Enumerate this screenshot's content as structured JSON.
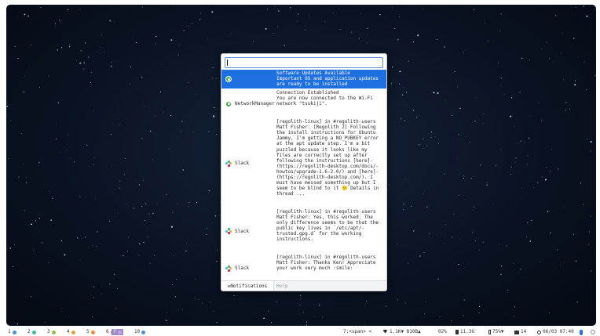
{
  "launcher": {
    "search_value": "",
    "notifications": [
      {
        "app": "",
        "icon": "network-manager-icon",
        "lines": [
          "Software Updates Available",
          "Important OS and application updates",
          "are ready to be installed"
        ],
        "selected": true
      },
      {
        "app": "NetworkManager",
        "icon": "network-manager-icon",
        "lines": [
          "Connection Established",
          "You are now connected to the Wi-Fi",
          "network \"tsukiji\"."
        ],
        "selected": false
      },
      {
        "app": "Slack",
        "icon": "slack-icon",
        "lines": [
          "[regolith-linux] in #regolith-users",
          "Matt Fisher: [Regolith 2] Following",
          "the install instructions for Ubuntu",
          "Jammy, I'm getting a NO_PUBKEY error",
          "at the apt update step. I'm a bit",
          "puzzled because it looks like my",
          "files are correctly set up after",
          "following the instructions [here]-",
          "(https://regolith-desktop.com/docs/-",
          "howtos/upgrade-1.6-2.0/) and [here]-",
          "(https://regolith-desktop.com/). I",
          "must have messed something up but I",
          "seem to be blind to it 😕 Details in",
          "thread ..."
        ],
        "selected": false
      },
      {
        "app": "Slack",
        "icon": "slack-icon",
        "lines": [
          "[regolith-linux] in #regolith-users",
          "Matt Fisher: Yes, this worked. The",
          "only difference seems to be that the",
          "public key lives in `/etc/apt/-",
          "trusted.gpg.d` for the working",
          "instructions."
        ],
        "selected": false
      },
      {
        "app": "Slack",
        "icon": "slack-icon",
        "lines": [
          "[regolith-linux] in #regolith-users",
          "Matt Fisher: Thanks Ken! Appreciate",
          "your work very much :smile:"
        ],
        "selected": false
      }
    ],
    "tabs": {
      "notifications": "✉Notifications",
      "help": "Help"
    }
  },
  "statusbar": {
    "workspaces": [
      {
        "label": "1",
        "color": "#4a90d9"
      },
      {
        "label": "2",
        "color": "#3fb6a8"
      },
      {
        "label": "3",
        "color": "#8bc34a"
      },
      {
        "label": "4",
        "color": "#f0a030"
      },
      {
        "label": "5",
        "color": "#ef8a3c"
      },
      {
        "label": "6",
        "color": "#e05555"
      },
      {
        "label": "7",
        "color": "#c9a0f0",
        "active": true
      },
      {
        "label": "10",
        "color": "#4a90d9"
      }
    ],
    "window": "7:<span> <",
    "net": "1.1K▼ 810B▲",
    "cpu": "02%",
    "mem": "11.3G",
    "battery": "75%▼",
    "notifications_count": "14",
    "datetime": "06/03 07:40"
  }
}
